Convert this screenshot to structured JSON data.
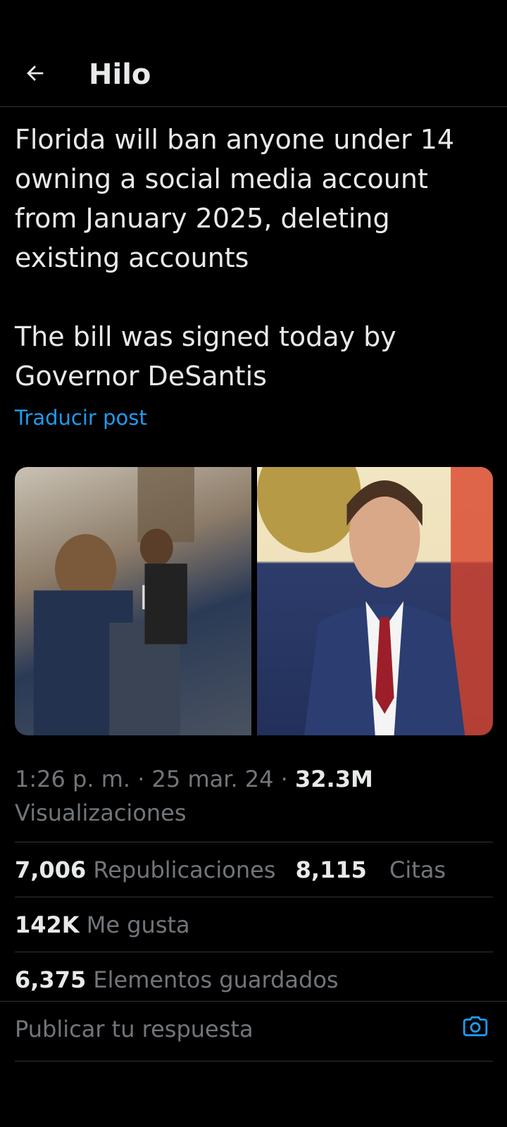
{
  "header": {
    "title": "Hilo",
    "back_icon": "arrow-left-icon"
  },
  "post": {
    "text": "Florida will ban anyone under 14 owning a social media account from January 2025, deleting existing accounts\n\nThe bill was signed today by Governor DeSantis",
    "translate_label": "Traducir post",
    "time": "1:26 p. m.",
    "date": "25 mar. 24",
    "views": "32.3M",
    "views_label": "Visualizaciones"
  },
  "stats": {
    "reposts_count": "7,006",
    "reposts_label": "Republicaciones",
    "quotes_count": "8,115",
    "quotes_label": "Citas",
    "likes_count": "142K",
    "likes_label": "Me gusta",
    "bookmarks_count": "6,375",
    "bookmarks_label": "Elementos guardados"
  },
  "reply": {
    "placeholder": "Publicar tu respuesta",
    "camera_icon": "camera-icon"
  },
  "colors": {
    "background": "#000000",
    "accent": "#1d9bf0",
    "text": "#e7e9ea",
    "muted": "#71767b"
  }
}
